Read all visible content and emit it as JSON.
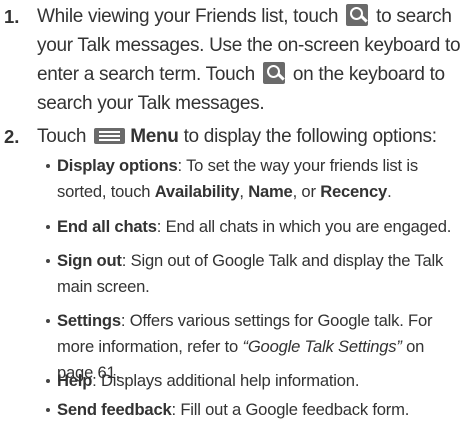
{
  "step1": {
    "number": "1.",
    "text_a": "While viewing your Friends list, touch",
    "text_b": "to search your Talk messages. Use the on-screen keyboard to enter a search term. Touch",
    "text_c": "on the keyboard to search your Talk messages.",
    "icon": "search-icon"
  },
  "step2": {
    "number": "2.",
    "text_a": "Touch",
    "menu_label": "Menu",
    "text_b": "to display the following options:",
    "icon": "menu-icon"
  },
  "options": [
    {
      "term": "Display options",
      "text": ": To set the way your friends list is sorted, touch ",
      "choice1": "Availability",
      "sep1": ", ",
      "choice2": "Name",
      "sep2": ", or ",
      "choice3": "Recency",
      "end": "."
    },
    {
      "term": "End all chats",
      "text": ": End all chats in which you are engaged."
    },
    {
      "term": "Sign out",
      "text": ": Sign out of Google Talk and display the Talk main screen."
    },
    {
      "term": "Settings",
      "text": ": Offers various settings for Google talk. For more information, refer to ",
      "ref": "“Google Talk Settings”",
      "end": " on page 61."
    },
    {
      "term": "Help",
      "text": ": Displays additional help information."
    },
    {
      "term": "Send feedback",
      "text": ": Fill out a Google feedback form."
    }
  ],
  "colors": {
    "text": "#333333",
    "icon_bg": "#6a6a6a"
  }
}
